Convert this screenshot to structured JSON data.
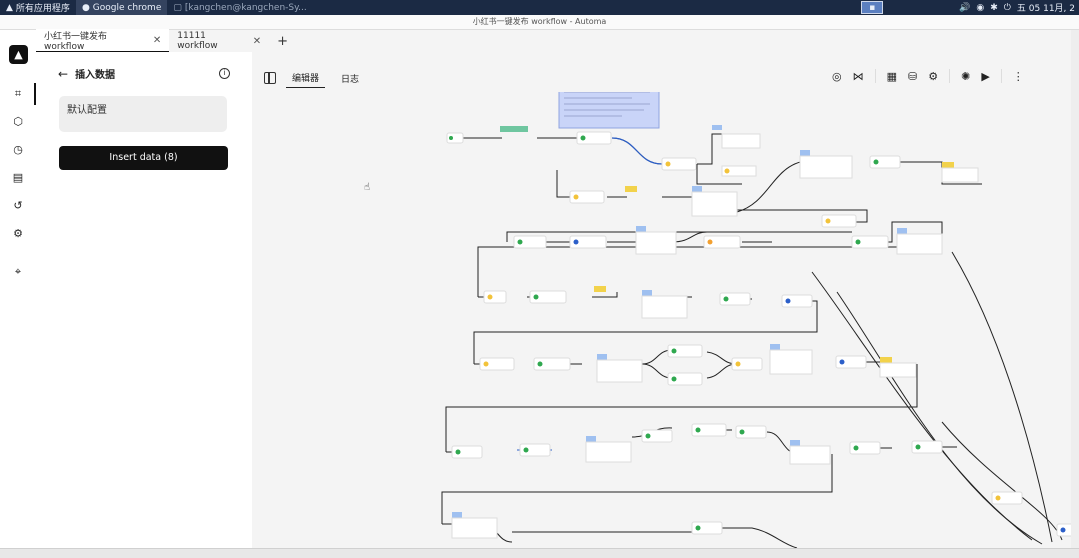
{
  "taskbar": {
    "apps_label": "所有应用程序",
    "tab1": "Google chrome",
    "tab2": "[kangchen@kangchen-Sy...",
    "clock": "五 05 11月, 2"
  },
  "window": {
    "title": "小红书一键发布 workflow - Automa"
  },
  "tabs": [
    {
      "label": "小红书一键发布 workflow"
    },
    {
      "label": "11111 workflow"
    }
  ],
  "new_tab": "+",
  "panel": {
    "title": "插入数据",
    "textarea_value": "默认配置",
    "insert_button": "Insert data (8)"
  },
  "editor_tabs": {
    "editor": "编辑器",
    "logs": "日志"
  },
  "icons": {
    "logo": "automa-logo",
    "rail": [
      "workflow-icon",
      "package-icon",
      "clock-icon",
      "storage-icon",
      "history-icon",
      "settings-icon",
      "crosshair-icon"
    ],
    "toolbar": [
      "broadcast-icon",
      "share-icon",
      "table-icon",
      "database-icon",
      "gear-icon",
      "bug-icon",
      "play-icon",
      "more-icon"
    ]
  },
  "colors": {
    "accent": "#111111",
    "node_green": "#2fa84f",
    "node_yellow": "#f2d24b",
    "node_blue": "#4a7fd6",
    "note_bg": "#c9d4f8"
  }
}
